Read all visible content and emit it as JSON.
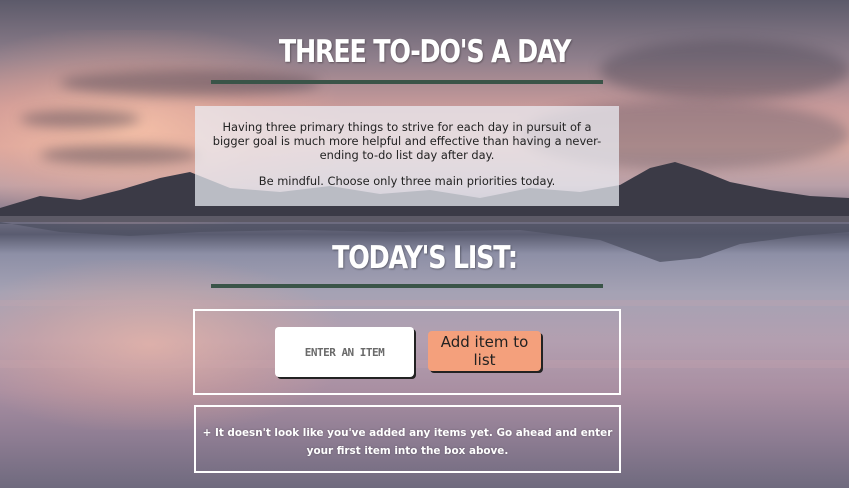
{
  "header": {
    "title": "THREE TO-DO'S A DAY"
  },
  "intro": {
    "paragraph1": "Having three primary things to strive for each day in pursuit of a bigger goal is much more helpful and effective than having a never-ending to-do list day after day.",
    "paragraph2": "Be mindful. Choose only three main priorities today."
  },
  "list": {
    "heading": "TODAY'S LIST:",
    "input_placeholder": "ENTER AN ITEM",
    "input_value": "",
    "add_button_label": "Add item to list",
    "empty_message": "+ It doesn't look like you've added any items yet. Go ahead and enter your first item into the box above."
  },
  "colors": {
    "rule": "#3a5448",
    "button": "#f4a07c",
    "text_light": "#ffffff"
  }
}
